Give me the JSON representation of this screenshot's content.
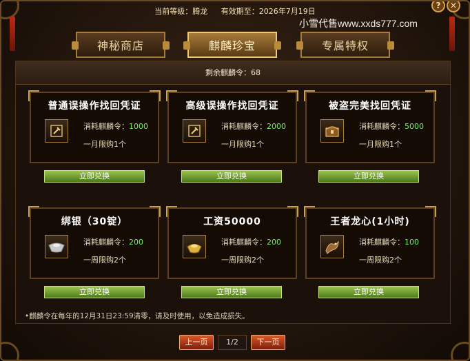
{
  "header": {
    "level_label": "当前等级：",
    "level_value": "腾龙",
    "expiry_label": "有效期至：",
    "expiry_value": "2026年7月19日",
    "help_symbol": "?",
    "close_symbol": "×",
    "watermark": "小雪代售www.xxds777.com"
  },
  "tabs": [
    {
      "label": "神秘商店",
      "active": false
    },
    {
      "label": "麒麟珍宝",
      "active": true
    },
    {
      "label": "专属特权",
      "active": false
    }
  ],
  "panel": {
    "remaining": "剩余麒麟令：68"
  },
  "items": [
    {
      "title": "普通误操作找回凭证",
      "icon": "hammer-icon",
      "cost_label": "消耗麒麟令：",
      "cost_value": "1000",
      "limit": "一月限购1个",
      "button": "立即兑换"
    },
    {
      "title": "高级误操作找回凭证",
      "icon": "hammer-icon",
      "cost_label": "消耗麒麟令：",
      "cost_value": "2000",
      "limit": "一月限购1个",
      "button": "立即兑换"
    },
    {
      "title": "被盗完美找回凭证",
      "icon": "chest-icon",
      "cost_label": "消耗麒麟令：",
      "cost_value": "5000",
      "limit": "一月限购1个",
      "button": "立即兑换"
    },
    {
      "title": "绑银（30锭）",
      "icon": "silver-ingot-icon",
      "cost_label": "消耗麒麟令：",
      "cost_value": "200",
      "limit": "一周限购2个",
      "button": "立即兑换"
    },
    {
      "title": "工资50000",
      "icon": "gold-ingot-icon",
      "cost_label": "消耗麒麟令：",
      "cost_value": "200",
      "limit": "一周限购2个",
      "button": "立即兑换"
    },
    {
      "title": "王者龙心(1小时)",
      "icon": "dragon-icon",
      "cost_label": "消耗麒麟令：",
      "cost_value": "100",
      "limit": "一周限购2个",
      "button": "立即兑换"
    }
  ],
  "note": "•麒麟令在每年的12月31日23:59清零，请及时使用，以免造成损失。",
  "pager": {
    "prev_label": "上一页",
    "page": "1/2",
    "next_label": "下一页"
  },
  "colors": {
    "accent_gold": "#c7a051",
    "cost_green": "#7cf06a",
    "button_green": "#6a9a2e",
    "pager_red": "#b83a16"
  }
}
